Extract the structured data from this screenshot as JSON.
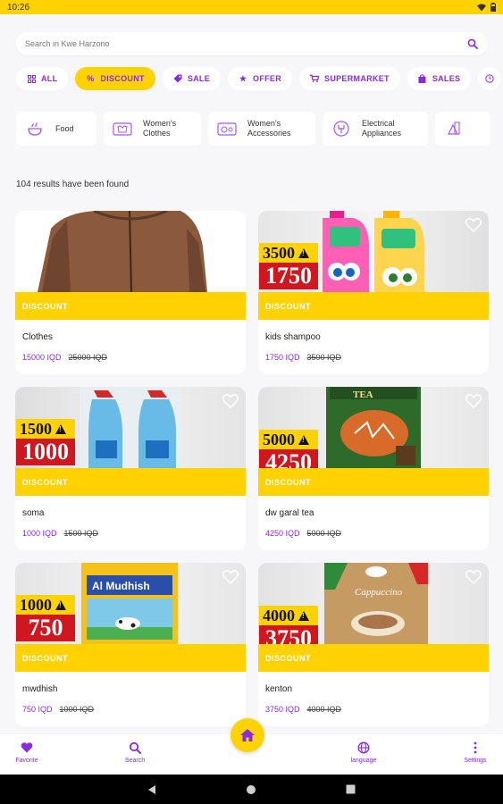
{
  "status": {
    "time": "10:26"
  },
  "search": {
    "placeholder": "Search in Kwe Harzono"
  },
  "tags": [
    {
      "label": "ALL",
      "icon": "grid-icon"
    },
    {
      "label": "DISCOUNT",
      "icon": "percent-icon",
      "active": true
    },
    {
      "label": "SALE",
      "icon": "tag-icon"
    },
    {
      "label": "OFFER",
      "icon": "star-icon"
    },
    {
      "label": "SUPERMARKET",
      "icon": "cart-icon"
    },
    {
      "label": "SALES",
      "icon": "bag-icon"
    }
  ],
  "categories": [
    {
      "label": "Food",
      "icon": "food-icon"
    },
    {
      "label": "Women's\nClothes",
      "icon": "clothes-icon"
    },
    {
      "label": "Women's\nAccessories",
      "icon": "accessories-icon"
    },
    {
      "label": "Electrical\nAppliances",
      "icon": "appliances-icon"
    }
  ],
  "results_text": "104 results have been found",
  "products": [
    {
      "name": "Clothes",
      "price": "15000 IQD",
      "old_price": "25000 IQD",
      "badge": "DISCOUNT",
      "sticker": null
    },
    {
      "name": "kids shampoo",
      "price": "1750 IQD",
      "old_price": "3500 IQD",
      "badge": "DISCOUNT",
      "sticker": {
        "old": "3500",
        "new": "1750"
      }
    },
    {
      "name": "soma",
      "price": "1000 IQD",
      "old_price": "1500 IQD",
      "badge": "DISCOUNT",
      "sticker": {
        "old": "1500",
        "new": "1000"
      }
    },
    {
      "name": "dw garal tea",
      "price": "4250 IQD",
      "old_price": "5000 IQD",
      "badge": "DISCOUNT",
      "sticker": {
        "old": "5000",
        "new": "4250"
      }
    },
    {
      "name": "mwdhish",
      "price": "750 IQD",
      "old_price": "1000 IQD",
      "badge": "DISCOUNT",
      "sticker": {
        "old": "1000",
        "new": "750"
      }
    },
    {
      "name": "kenton",
      "price": "3750 IQD",
      "old_price": "4000 IQD",
      "badge": "DISCOUNT",
      "sticker": {
        "old": "4000",
        "new": "3750"
      }
    }
  ],
  "product_art": {
    "tea_box_label": "TEA",
    "milk_bag_label": "Al Mudhish",
    "coffee_label": "Cappuccino"
  },
  "nav": {
    "favorite": "Favorite",
    "search": "Search",
    "language": "language",
    "settings": "Settings"
  },
  "colors": {
    "accent": "#8a2be2",
    "brand": "#ffd200",
    "price_red": "#d0161f"
  }
}
